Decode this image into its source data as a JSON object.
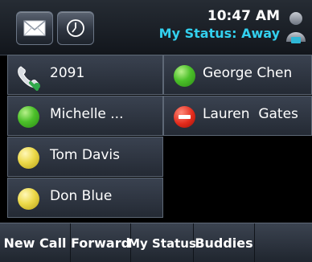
{
  "header": {
    "time": "10:47 AM",
    "status": "My Status: Away"
  },
  "lines": [
    {
      "label": "2091",
      "icon": "phone-line-icon"
    },
    {
      "label": "Michelle ...",
      "presence": "available",
      "color": "#4cc12a"
    },
    {
      "label": "Tom Davis",
      "presence": "away",
      "color": "#ecd94a"
    },
    {
      "label": "Don Blue",
      "presence": "away",
      "color": "#ecd94a"
    },
    {
      "label": "George Chen",
      "presence": "available",
      "color": "#4cc12a"
    },
    {
      "label": "Lauren  Gates",
      "presence": "busy",
      "color": "#e22a1b"
    }
  ],
  "softkeys": [
    "New Call",
    "Forward",
    "My Status",
    "Buddies",
    ""
  ],
  "colors": {
    "status_text": "#33d0ee",
    "available": "#4cc12a",
    "away": "#ecd94a",
    "busy": "#e22a1b"
  }
}
